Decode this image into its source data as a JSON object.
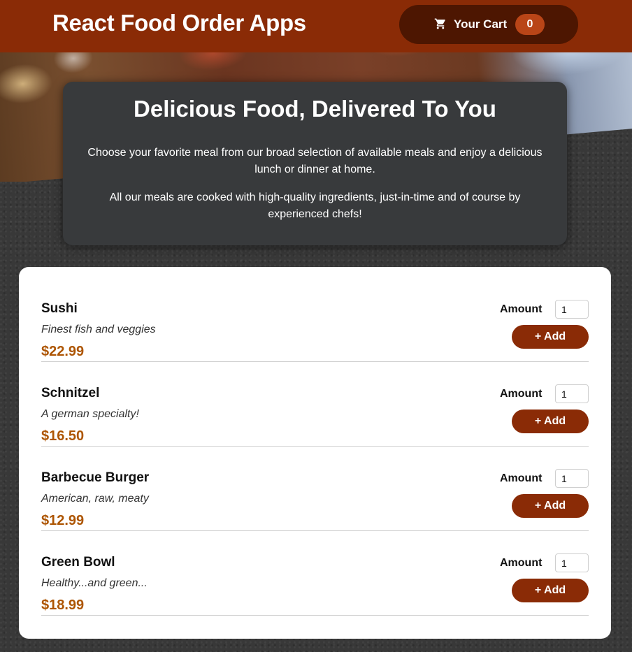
{
  "header": {
    "title": "React Food Order Apps",
    "cart_label": "Your Cart",
    "cart_count": "0",
    "cart_icon": "shopping-cart-icon"
  },
  "summary": {
    "title": "Delicious Food, Delivered To You",
    "paragraph1": "Choose your favorite meal from our broad selection of available meals and enjoy a delicious lunch or dinner at home.",
    "paragraph2": "All our meals are cooked with high-quality ingredients, just-in-time and of course by experienced chefs!"
  },
  "meals": [
    {
      "name": "Sushi",
      "description": "Finest fish and veggies",
      "price": "$22.99",
      "amount_label": "Amount",
      "amount": "1",
      "add_label": "+ Add"
    },
    {
      "name": "Schnitzel",
      "description": "A german specialty!",
      "price": "$16.50",
      "amount_label": "Amount",
      "amount": "1",
      "add_label": "+ Add"
    },
    {
      "name": "Barbecue Burger",
      "description": "American, raw, meaty",
      "price": "$12.99",
      "amount_label": "Amount",
      "amount": "1",
      "add_label": "+ Add"
    },
    {
      "name": "Green Bowl",
      "description": "Healthy...and green...",
      "price": "$18.99",
      "amount_label": "Amount",
      "amount": "1",
      "add_label": "+ Add"
    }
  ],
  "colors": {
    "header_bg": "#8a2b06",
    "cart_button_bg": "#4d1601",
    "badge_bg": "#b94517",
    "price": "#ad5502",
    "summary_bg": "#383a3c"
  }
}
